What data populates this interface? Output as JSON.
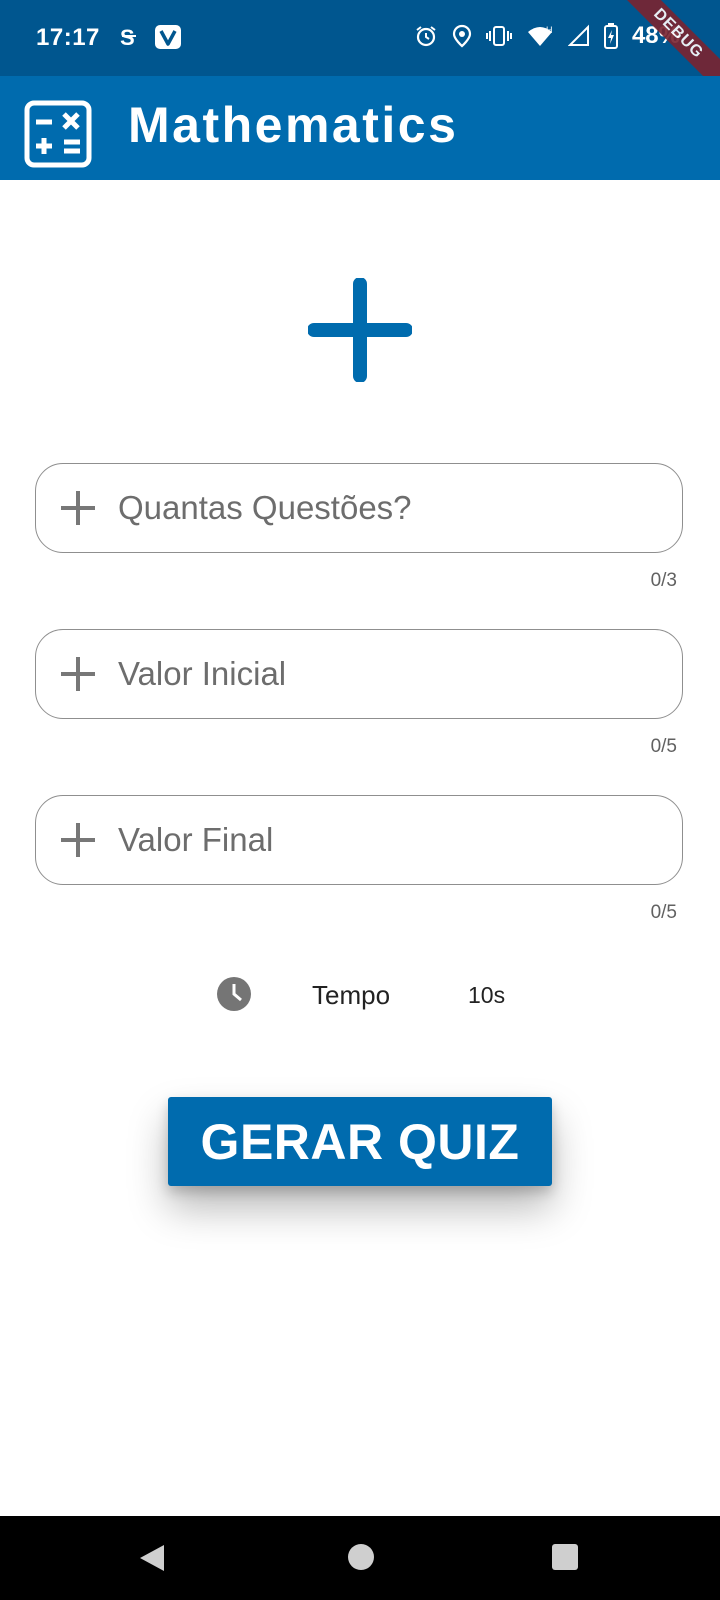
{
  "status_bar": {
    "time": "17:17",
    "battery": "48%",
    "icons_left": [
      "s-sim-icon",
      "v-app-icon"
    ],
    "icons_right": [
      "alarm-icon",
      "location-icon",
      "vibrate-icon",
      "wifi-icon",
      "signal-icon",
      "battery-charging-icon"
    ],
    "debug_label": "DEBUG"
  },
  "app_bar": {
    "title": "Mathematics",
    "icon": "calculator-icon",
    "color": "#006bae"
  },
  "hero": {
    "icon": "plus-icon",
    "color": "#006bae"
  },
  "fields": [
    {
      "placeholder": "Quantas Questões?",
      "value": "",
      "counter": "0/3",
      "icon": "plus-icon"
    },
    {
      "placeholder": "Valor Inicial",
      "value": "",
      "counter": "0/5",
      "icon": "plus-icon"
    },
    {
      "placeholder": "Valor Final",
      "value": "",
      "counter": "0/5",
      "icon": "plus-icon"
    }
  ],
  "tempo": {
    "label": "Tempo",
    "value": "10s",
    "icon": "clock-icon"
  },
  "button": {
    "label": "GERAR QUIZ",
    "color": "#006bae"
  },
  "nav_bar": {
    "icons": [
      "back-icon",
      "home-icon",
      "recents-icon"
    ]
  }
}
